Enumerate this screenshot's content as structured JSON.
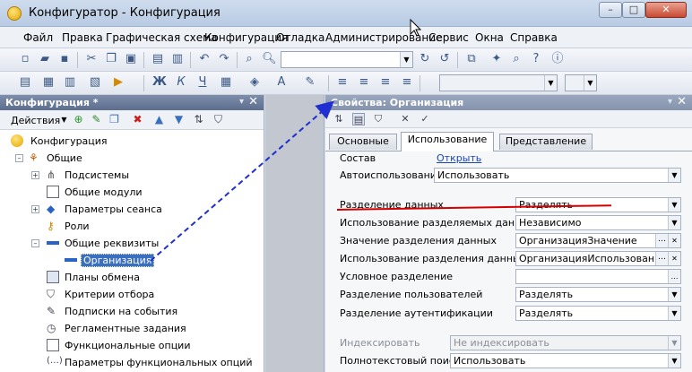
{
  "window": {
    "title": "Конфигуратор - Конфигурация",
    "min_label": "–",
    "max_label": "□",
    "close_label": "✕"
  },
  "menu": [
    "Файл",
    "Правка",
    "Графическая схема",
    "Конфигурация",
    "Отладка",
    "Администрирование",
    "Сервис",
    "Окна",
    "Справка"
  ],
  "toolbar2": {
    "bold": "Ж",
    "italic": "К",
    "underline": "Ч"
  },
  "left_panel": {
    "title": "Конфигурация *",
    "actions_label": "Действия",
    "tree": [
      {
        "label": "Конфигурация",
        "icon": "configuration-icon"
      },
      {
        "label": "Общие",
        "icon": "common-icon"
      },
      {
        "label": "Подсистемы",
        "icon": "subsystems-icon"
      },
      {
        "label": "Общие модули",
        "icon": "common-modules-icon"
      },
      {
        "label": "Параметры сеанса",
        "icon": "session-params-icon"
      },
      {
        "label": "Роли",
        "icon": "roles-icon"
      },
      {
        "label": "Общие реквизиты",
        "icon": "common-attributes-icon"
      },
      {
        "label": "Организация",
        "icon": "attribute-icon"
      },
      {
        "label": "Планы обмена",
        "icon": "exchange-plans-icon"
      },
      {
        "label": "Критерии отбора",
        "icon": "filter-criteria-icon"
      },
      {
        "label": "Подписки на события",
        "icon": "event-subscriptions-icon"
      },
      {
        "label": "Регламентные задания",
        "icon": "scheduled-jobs-icon"
      },
      {
        "label": "Функциональные опции",
        "icon": "functional-options-icon"
      },
      {
        "label": "Параметры функциональных опций",
        "icon": "fo-params-icon"
      }
    ]
  },
  "props_panel": {
    "title": "Свойства: Организация",
    "tabs": [
      "Основные",
      "Использование",
      "Представление"
    ],
    "active_tab": "Использование",
    "rows": [
      {
        "label": "Состав",
        "value": "Открыть"
      },
      {
        "label": "Автоиспользование",
        "value": "Использовать"
      },
      {
        "label": "Разделение данных",
        "value": "Разделять"
      },
      {
        "label": "Использование разделяемых данных",
        "value": "Независимо"
      },
      {
        "label": "Значение разделения данных",
        "value": "ОрганизацияЗначение"
      },
      {
        "label": "Использование разделения данных",
        "value": "ОрганизацияИспользование"
      },
      {
        "label": "Условное разделение",
        "value": ""
      },
      {
        "label": "Разделение пользователей",
        "value": "Разделять"
      },
      {
        "label": "Разделение аутентификации",
        "value": "Разделять"
      },
      {
        "label": "Индексировать",
        "value": "Не индексировать"
      },
      {
        "label": "Полнотекстовый поиск",
        "value": "Использовать"
      }
    ]
  },
  "colors": {
    "annotation_arrow": "#1f2fd1",
    "annotation_underline": "#d40000",
    "selection": "#3a6fc0"
  }
}
